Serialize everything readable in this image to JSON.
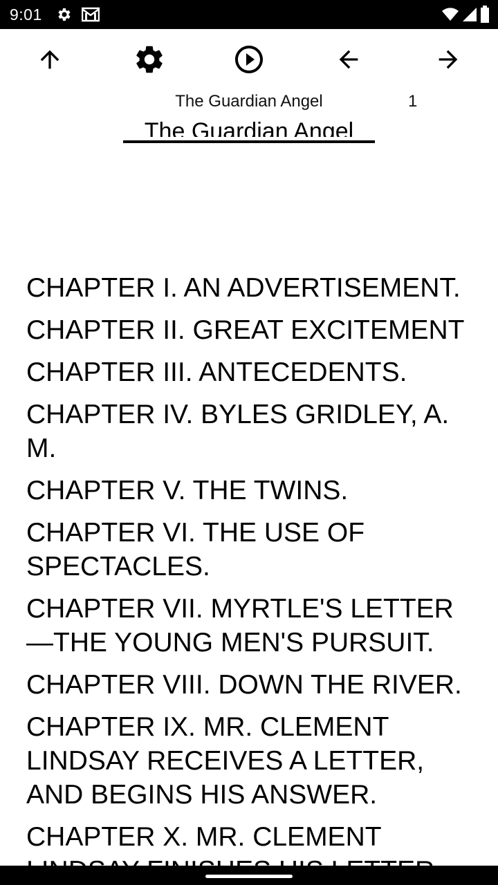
{
  "status_bar": {
    "time": "9:01",
    "left_icons": [
      "gear-icon",
      "gmail-icon"
    ],
    "right_icons": [
      "wifi-icon",
      "signal-icon",
      "battery-icon"
    ]
  },
  "toolbar": {
    "buttons": [
      {
        "name": "up-button",
        "icon": "arrow-up-icon"
      },
      {
        "name": "settings-button",
        "icon": "gear-icon"
      },
      {
        "name": "play-button",
        "icon": "play-circle-icon"
      },
      {
        "name": "back-button",
        "icon": "arrow-left-icon"
      },
      {
        "name": "forward-button",
        "icon": "arrow-right-icon"
      }
    ]
  },
  "header": {
    "book_title_small": "The Guardian Angel",
    "page_number": "1",
    "book_title_large": "The Guardian Angel"
  },
  "chapters": [
    "CHAPTER I. AN ADVERTISEMENT.",
    "CHAPTER II. GREAT EXCITEMENT",
    "CHAPTER III. ANTECEDENTS.",
    "CHAPTER IV. BYLES GRIDLEY, A. M.",
    "CHAPTER V. THE TWINS.",
    "CHAPTER VI. THE USE OF SPECTACLES.",
    "CHAPTER VII. MYRTLE'S LETTER—THE YOUNG MEN'S PURSUIT.",
    "CHAPTER VIII. DOWN THE RIVER.",
    "CHAPTER IX. MR. CLEMENT LINDSAY RECEIVES A LETTER, AND BEGINS HIS ANSWER.",
    "CHAPTER X. MR. CLEMENT LINDSAY FINISHES HIS LETTER."
  ],
  "colors": {
    "background": "#ffffff",
    "text": "#000000",
    "status_bar": "#000000"
  }
}
